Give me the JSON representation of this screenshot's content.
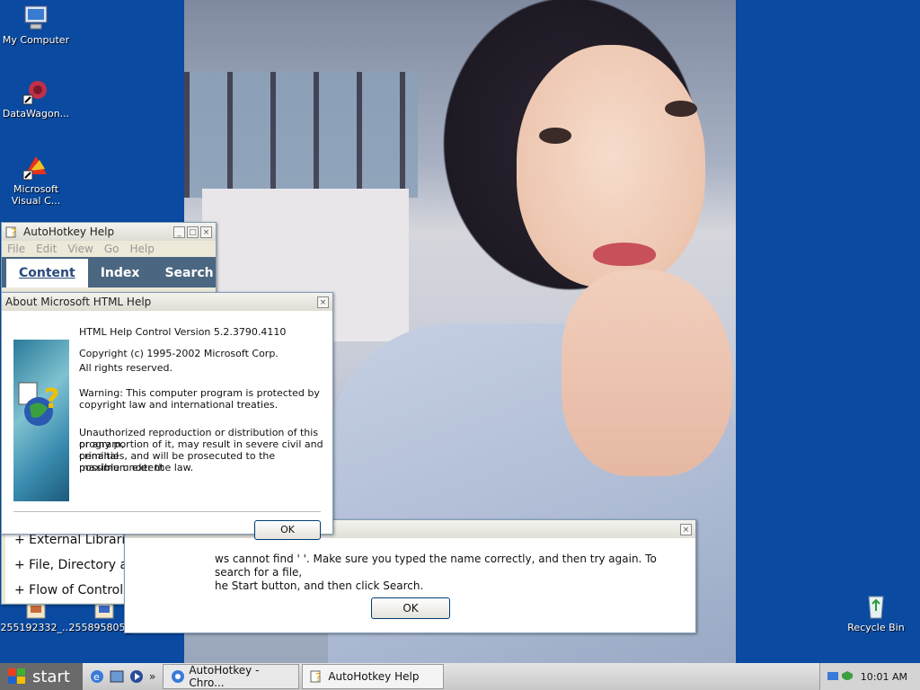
{
  "desktop": {
    "icons": [
      {
        "label": "My Computer"
      },
      {
        "label": "DataWagon..."
      },
      {
        "label": "Microsoft Visual C..."
      },
      {
        "label": "255192332_..."
      },
      {
        "label": "255895805_..."
      },
      {
        "label": "Recycle Bin"
      }
    ]
  },
  "ahk_window": {
    "title": "AutoHotkey Help",
    "menu": [
      "File",
      "Edit",
      "View",
      "Go",
      "Help"
    ],
    "tabs": [
      "Content",
      "Index",
      "Search"
    ],
    "tree": [
      "+  External Libraries",
      "+  File, Directory and Disk",
      "+  Flow of Control"
    ]
  },
  "about_dialog": {
    "title": "About Microsoft HTML Help",
    "version": "HTML Help Control Version 5.2.3790.4110",
    "copyright": "Copyright (c) 1995-2002 Microsoft Corp.",
    "rights": "All rights reserved.",
    "warning_1": "Warning: This computer program is protected by",
    "warning_2": "copyright law and international treaties.",
    "unauth_1": "Unauthorized reproduction or distribution of this program,",
    "unauth_2": "or any portion of it, may result in severe civil and criminal",
    "unauth_3": "penalties, and will be prosecuted to the maximum extent",
    "unauth_4": "possible under the law.",
    "ok_label": "OK"
  },
  "error_dialog": {
    "line_1": "ws cannot find '   '. Make sure you typed the name correctly, and then try again. To search for a file,",
    "line_2": "he Start button, and then click Search.",
    "ok_label": "OK"
  },
  "taskbar": {
    "start_label": "start",
    "tasks": [
      "AutoHotkey - Chro...",
      "AutoHotkey Help"
    ],
    "clock": "10:01 AM"
  },
  "colors": {
    "desktop": "#0a4aa0",
    "tab_bar": "#4a6680"
  }
}
